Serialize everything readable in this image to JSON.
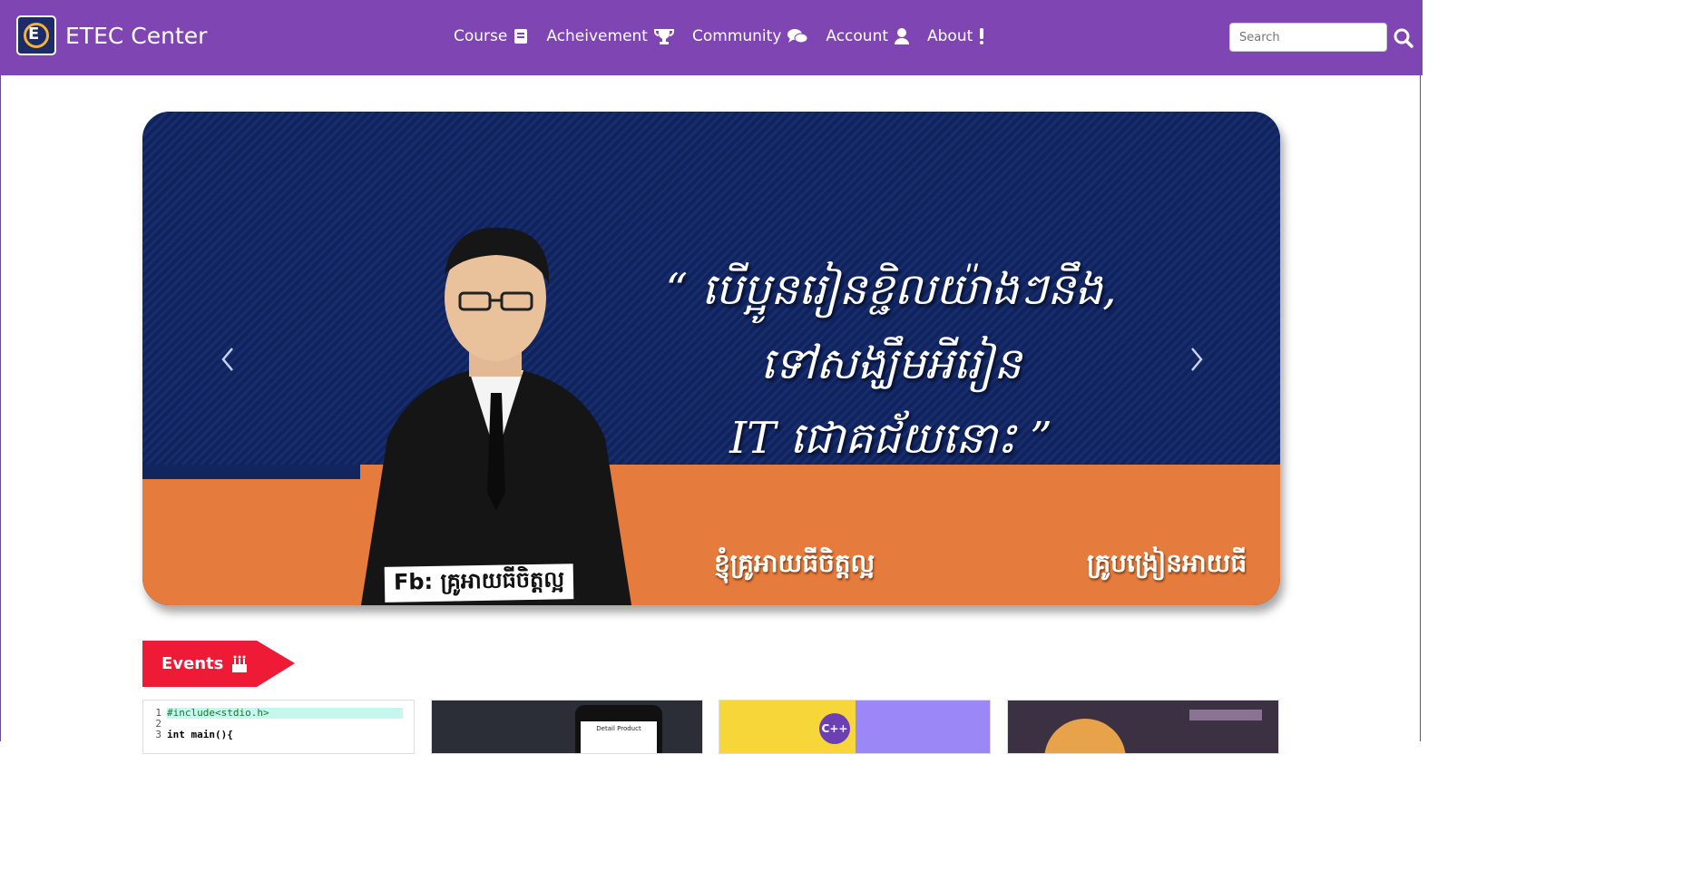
{
  "header": {
    "brand": "ETEC Center",
    "nav": [
      {
        "label": "Course",
        "icon": "book-icon"
      },
      {
        "label": "Acheivement",
        "icon": "trophy-icon"
      },
      {
        "label": "Community",
        "icon": "comments-icon"
      },
      {
        "label": "Account",
        "icon": "user-icon"
      },
      {
        "label": "About",
        "icon": "exclamation-icon"
      }
    ],
    "search_placeholder": "Search"
  },
  "banner": {
    "quote_line1": "“ បើប្អូនរៀនខ្ជិលយ៉ាងៗនឹង,",
    "quote_line2": "ទៅសង្ឃឹមអីរៀន",
    "quote_line3": "IT ជោគជ័យនោះ ”",
    "fb_label": "Fb: គ្រូអាយធីចិត្តល្អ",
    "name": "ខ្ញុំគ្រូអាយធីចិត្តល្អ",
    "title": "គ្រូបង្រៀនអាយធី"
  },
  "events": {
    "label": "Events",
    "cards": [
      {
        "code": [
          "#include<stdio.h>",
          "",
          "int main(){"
        ]
      },
      {
        "caption": "Detail Product"
      },
      {
        "caption": "C++"
      },
      {
        "caption": ""
      }
    ]
  },
  "colors": {
    "header_bg": "#7f45b3",
    "banner_navy": "#11255f",
    "banner_orange": "#e57b3c",
    "events_red": "#ee1a36"
  }
}
